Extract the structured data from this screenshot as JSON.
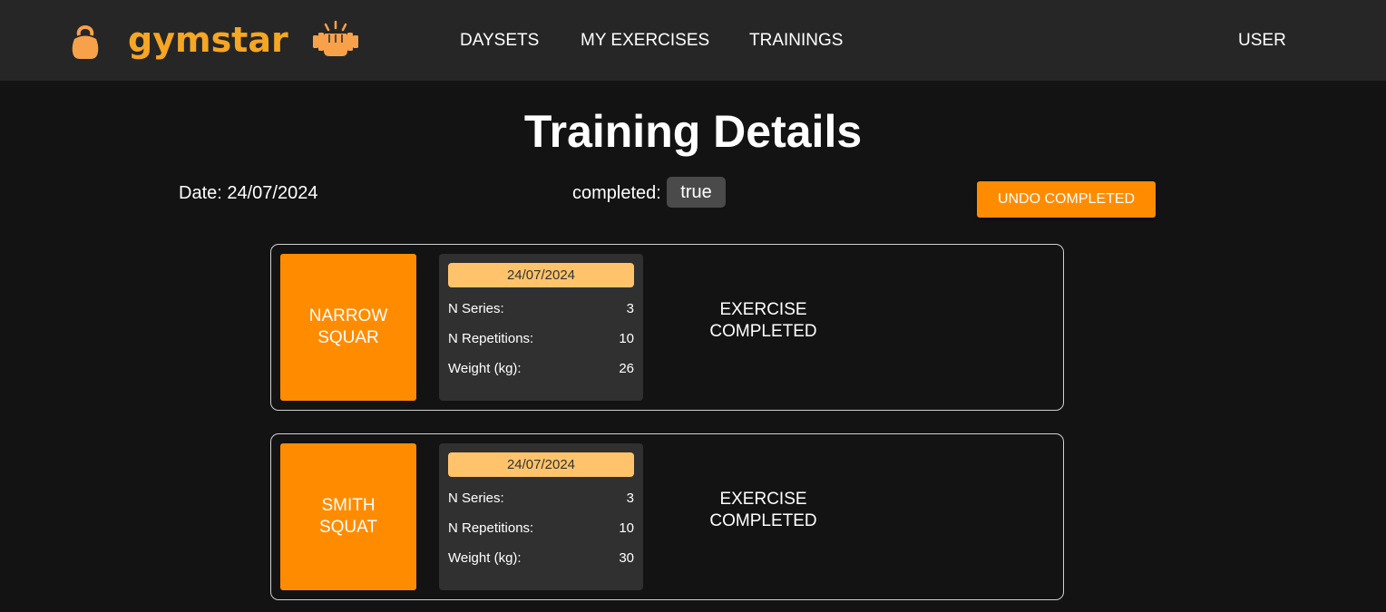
{
  "nav": {
    "logo_text": "gymstar",
    "items": [
      {
        "label": "DAYSETS"
      },
      {
        "label": "MY EXERCISES"
      },
      {
        "label": "TRAININGS"
      }
    ],
    "user_label": "USER"
  },
  "page": {
    "title": "Training Details",
    "date_text": "Date: 24/07/2024",
    "completed_label": "completed:",
    "completed_value": "true",
    "undo_button_label": "UNDO COMPLETED"
  },
  "exercises": [
    {
      "name": "NARROW SQUAR",
      "date": "24/07/2024",
      "series_label": "N Series:",
      "series_value": "3",
      "reps_label": "N Repetitions:",
      "reps_value": "10",
      "weight_label": "Weight (kg):",
      "weight_value": "26",
      "status": "EXERCISE COMPLETED"
    },
    {
      "name": "SMITH SQUAT",
      "date": "24/07/2024",
      "series_label": "N Series:",
      "series_value": "3",
      "reps_label": "N Repetitions:",
      "reps_value": "10",
      "weight_label": "Weight (kg):",
      "weight_value": "30",
      "status": "EXERCISE COMPLETED"
    }
  ],
  "colors": {
    "accent": "#ff8c00",
    "logo": "#f5a623",
    "date_badge": "#ffc46b",
    "navbar": "#262626",
    "background": "#131313"
  },
  "icons": {
    "logo_left": "kettlebell-icon",
    "logo_right": "fist-dumbbell-icon"
  }
}
